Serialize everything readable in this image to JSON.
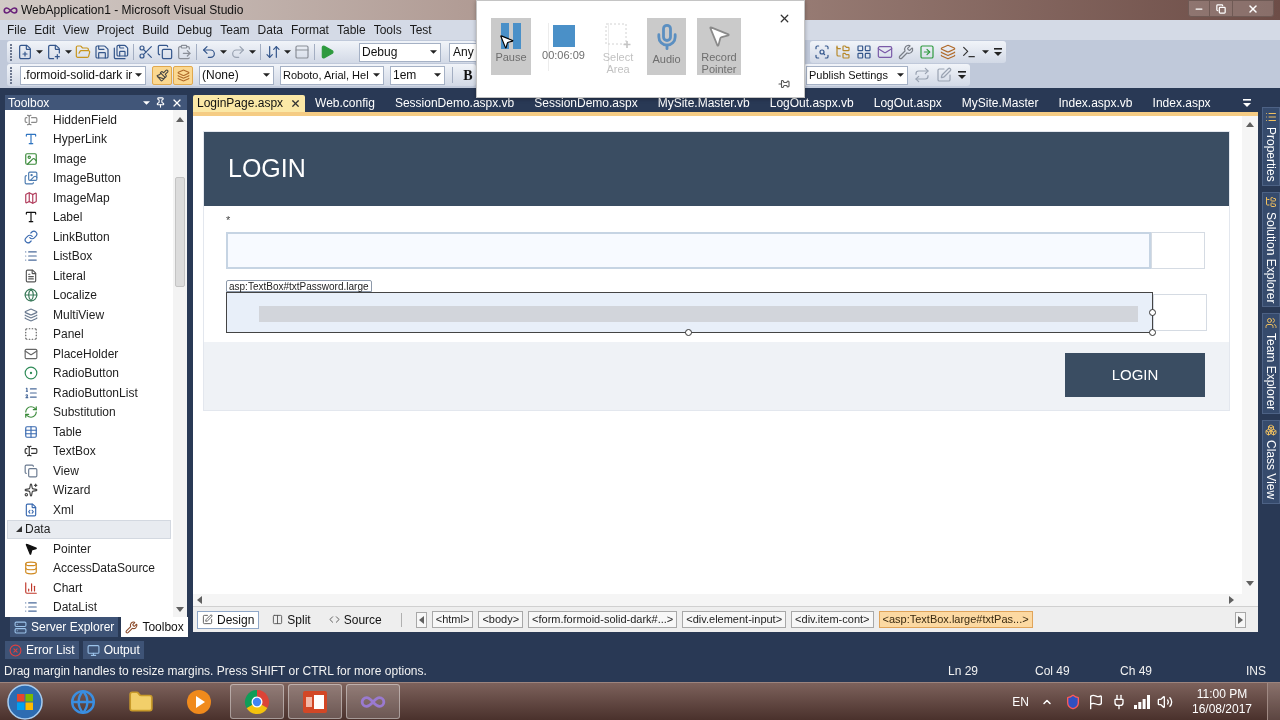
{
  "window": {
    "title": "WebApplication1 - Microsoft Visual Studio"
  },
  "menu_bar": {
    "items": [
      "File",
      "Edit",
      "View",
      "Project",
      "Build",
      "Debug",
      "Team",
      "Data",
      "Format",
      "Table",
      "Tools",
      "Test"
    ]
  },
  "standard_toolbar": {
    "configuration": "Debug",
    "platform": "Any"
  },
  "formatting_toolbar": {
    "css_class": ".formoid-solid-dark ir",
    "style_toggles": [
      {
        "pressed": true
      },
      {
        "pressed": true
      }
    ],
    "block_format": "(None)",
    "font_family": "Roboto, Arial, Hel",
    "font_size": "1em",
    "bold_button": "B"
  },
  "publish_toolbar": {
    "profile": "Publish Settings"
  },
  "recorder": {
    "buttons": [
      {
        "kind": "pause",
        "label": "Pause",
        "active": true,
        "disabled": false
      },
      {
        "kind": "stop",
        "label": "00:06:09",
        "active": false,
        "disabled": false
      },
      {
        "kind": "select_area",
        "label": "Select Area",
        "active": false,
        "disabled": true
      },
      {
        "kind": "audio",
        "label": "Audio",
        "active": true,
        "disabled": false
      },
      {
        "kind": "pointer",
        "label": "Record Pointer",
        "active": true,
        "disabled": false
      }
    ]
  },
  "toolbox": {
    "title": "Toolbox",
    "entries": [
      {
        "kind": "tool",
        "label": "HiddenField"
      },
      {
        "kind": "tool",
        "label": "HyperLink"
      },
      {
        "kind": "tool",
        "label": "Image"
      },
      {
        "kind": "tool",
        "label": "ImageButton"
      },
      {
        "kind": "tool",
        "label": "ImageMap"
      },
      {
        "kind": "tool",
        "label": "Label"
      },
      {
        "kind": "tool",
        "label": "LinkButton"
      },
      {
        "kind": "tool",
        "label": "ListBox"
      },
      {
        "kind": "tool",
        "label": "Literal"
      },
      {
        "kind": "tool",
        "label": "Localize"
      },
      {
        "kind": "tool",
        "label": "MultiView"
      },
      {
        "kind": "tool",
        "label": "Panel"
      },
      {
        "kind": "tool",
        "label": "PlaceHolder"
      },
      {
        "kind": "tool",
        "label": "RadioButton"
      },
      {
        "kind": "tool",
        "label": "RadioButtonList"
      },
      {
        "kind": "tool",
        "label": "Substitution"
      },
      {
        "kind": "tool",
        "label": "Table"
      },
      {
        "kind": "tool",
        "label": "TextBox"
      },
      {
        "kind": "tool",
        "label": "View"
      },
      {
        "kind": "tool",
        "label": "Wizard"
      },
      {
        "kind": "tool",
        "label": "Xml"
      },
      {
        "kind": "group",
        "label": "Data",
        "expanded": true,
        "children": [
          {
            "kind": "tool",
            "label": "Pointer"
          },
          {
            "kind": "tool",
            "label": "AccessDataSource"
          },
          {
            "kind": "tool",
            "label": "Chart"
          },
          {
            "kind": "tool",
            "label": "DataList"
          }
        ]
      }
    ]
  },
  "toolbox_tabs": [
    {
      "label": "Server Explorer",
      "selected": false
    },
    {
      "label": "Toolbox",
      "selected": true
    }
  ],
  "document_tabs": [
    {
      "label": "LoginPage.aspx",
      "selected": true
    },
    {
      "label": "Web.config",
      "selected": false
    },
    {
      "label": "SessionDemo.aspx.vb",
      "selected": false
    },
    {
      "label": "SessionDemo.aspx",
      "selected": false
    },
    {
      "label": "MySite.Master.vb",
      "selected": false
    },
    {
      "label": "LogOut.aspx.vb",
      "selected": false
    },
    {
      "label": "LogOut.aspx",
      "selected": false
    },
    {
      "label": "MySite.Master",
      "selected": false
    },
    {
      "label": "Index.aspx.vb",
      "selected": false
    },
    {
      "label": "Index.aspx",
      "selected": false
    }
  ],
  "design_surface": {
    "header": "LOGIN",
    "required_mark": "*",
    "fields": [
      {
        "selected": false
      },
      {
        "selected": true,
        "tag": "asp:TextBox#txtPassword.large"
      }
    ],
    "button": "LOGIN"
  },
  "view_tabs": [
    {
      "label": "Design",
      "selected": true
    },
    {
      "label": "Split",
      "selected": false
    },
    {
      "label": "Source",
      "selected": false
    }
  ],
  "breadcrumb": [
    {
      "label": "<html>",
      "selected": false
    },
    {
      "label": "<body>",
      "selected": false
    },
    {
      "label": "<form.formoid-solid-dark#...>",
      "selected": false
    },
    {
      "label": "<div.element-input>",
      "selected": false
    },
    {
      "label": "<div.item-cont>",
      "selected": false
    },
    {
      "label": "<asp:TextBox.large#txtPas...>",
      "selected": true
    }
  ],
  "side_tabs": [
    "Properties",
    "Solution Explorer",
    "Team Explorer",
    "Class View"
  ],
  "output_tabs": [
    "Error List",
    "Output"
  ],
  "status_bar": {
    "message": "Drag margin handles to resize margins. Press SHIFT or CTRL for more options.",
    "line": "Ln 29",
    "column": "Col 49",
    "char": "Ch 49",
    "mode": "INS"
  },
  "taskbar": {
    "apps": [
      {
        "running": false
      },
      {
        "running": false
      },
      {
        "running": false
      },
      {
        "running": true
      },
      {
        "running": true
      },
      {
        "running": true
      }
    ],
    "language": "EN",
    "time": "11:00 PM",
    "date": "16/08/2017"
  }
}
